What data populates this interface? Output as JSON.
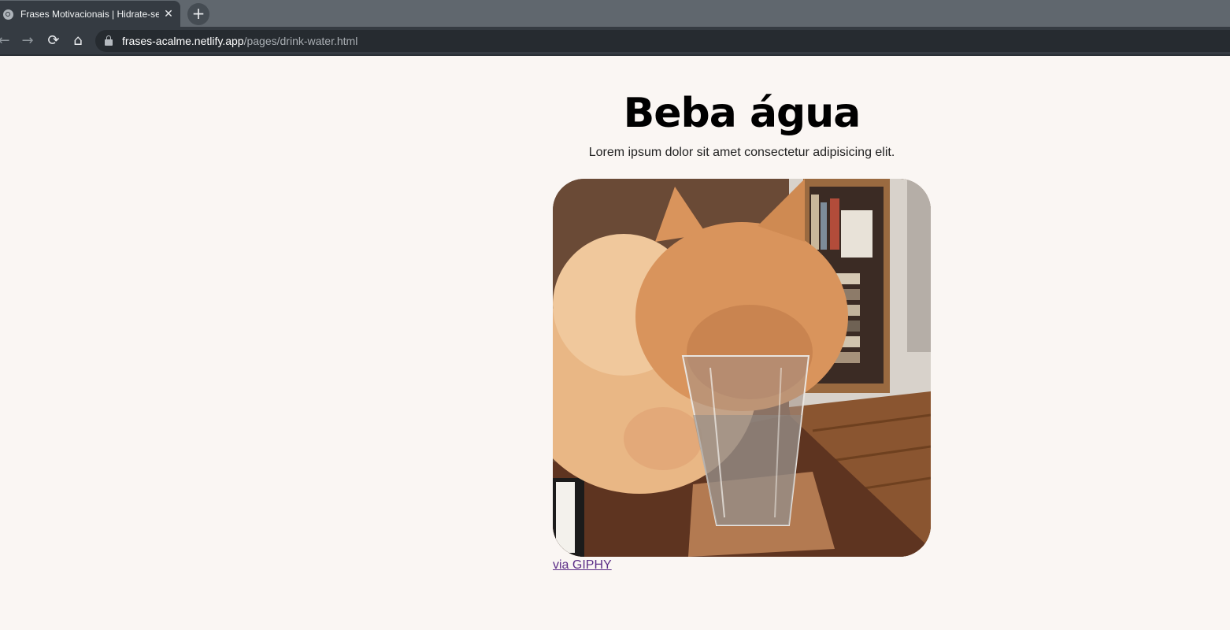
{
  "browser": {
    "tab_title": "Frases Motivacionais | Hidrate-se",
    "tab_close": "✕",
    "new_tab": "+",
    "nav": {
      "back": "←",
      "forward": "→",
      "reload": "⟳",
      "home": "⌂"
    },
    "url_host": "frases-acalme.netlify.app",
    "url_path": "/pages/drink-water.html"
  },
  "page": {
    "title": "Beba água",
    "subtitle": "Lorem ipsum dolor sit amet consectetur adipisicing elit.",
    "gif_alt": "cat drinking water from a glass",
    "credit_link": "via GIPHY"
  },
  "colors": {
    "page_background": "#faf6f3",
    "link_visited": "#5b2d87",
    "chrome_dark": "#353b42",
    "tabstrip": "#60676e"
  }
}
